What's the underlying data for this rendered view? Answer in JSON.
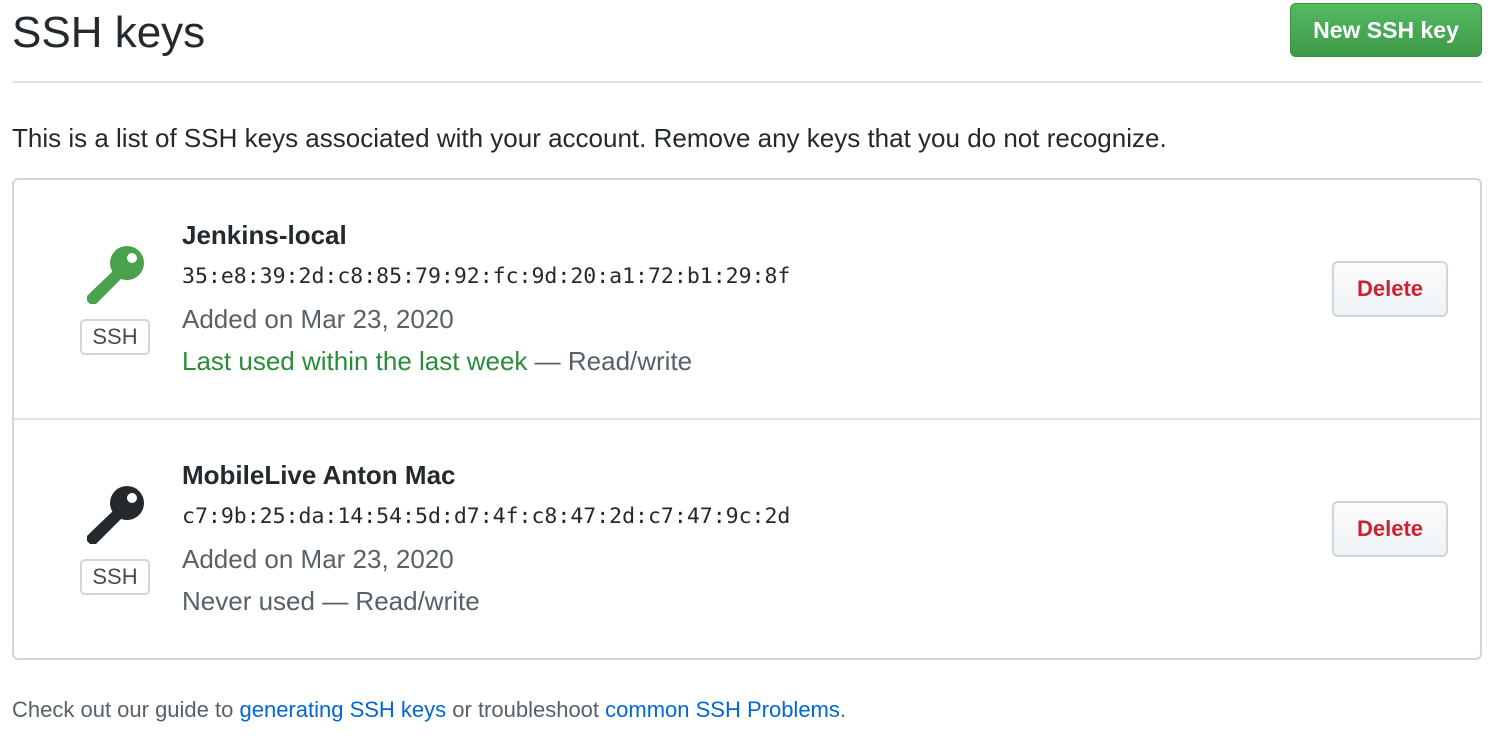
{
  "header": {
    "title": "SSH keys",
    "new_key_label": "New SSH key"
  },
  "intro": "This is a list of SSH keys associated with your account. Remove any keys that you do not recognize.",
  "keys": [
    {
      "title": "Jenkins-local",
      "fingerprint": "35:e8:39:2d:c8:85:79:92:fc:9d:20:a1:72:b1:29:8f",
      "badge": "SSH",
      "added": "Added on Mar 23, 2020",
      "last_used": "Last used within the last week",
      "access": " — Read/write",
      "delete_label": "Delete",
      "icon": "key-icon",
      "icon_color": "#4aa24f"
    },
    {
      "title": "MobileLive Anton Mac",
      "fingerprint": "c7:9b:25:da:14:54:5d:d7:4f:c8:47:2d:c7:47:9c:2d",
      "badge": "SSH",
      "added": "Added on Mar 23, 2020",
      "last_used": "Never used",
      "access": " — Read/write",
      "delete_label": "Delete",
      "icon": "key-icon",
      "icon_color": "#24292e"
    }
  ],
  "footer": {
    "prefix": "Check out our guide to ",
    "link1": "generating SSH keys",
    "middle": " or troubleshoot ",
    "link2": "common SSH Problems",
    "suffix": "."
  }
}
